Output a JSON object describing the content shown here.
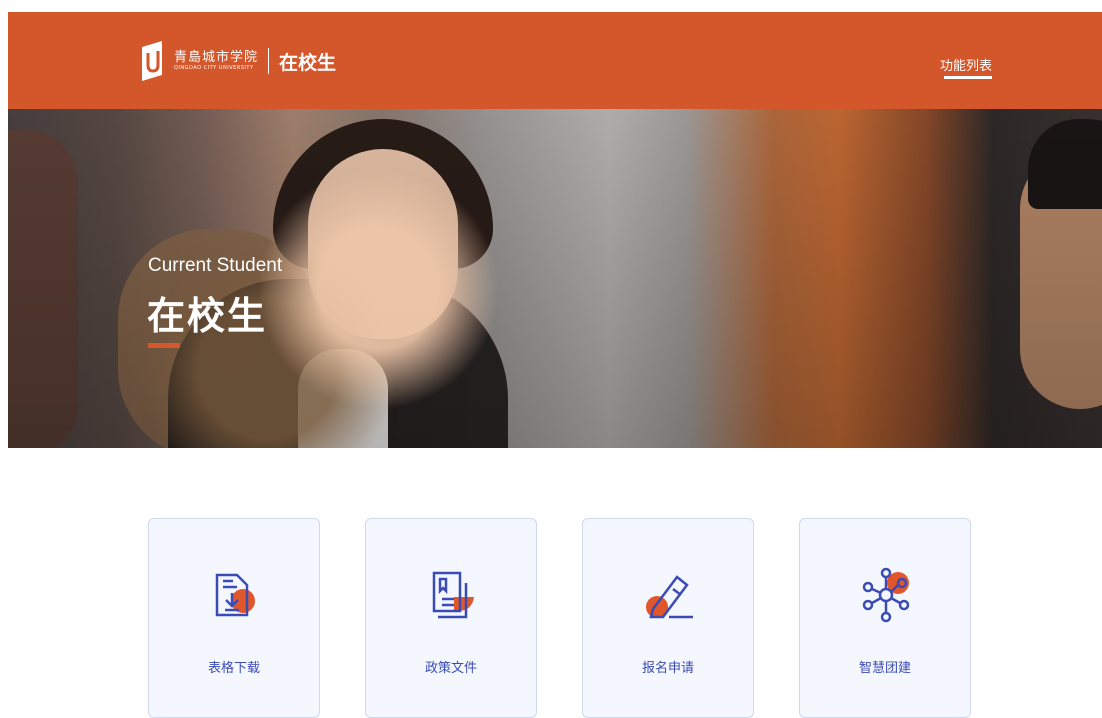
{
  "header": {
    "logo_cn": "青島城市学院",
    "logo_en": "QINGDAO CITY UNIVERSITY",
    "section": "在校生",
    "nav_link": "功能列表",
    "brand_color": "#d4562b"
  },
  "hero": {
    "subtitle": "Current Student",
    "title": "在校生"
  },
  "cards": [
    {
      "label": "表格下载",
      "icon": "form-download-icon"
    },
    {
      "label": "政策文件",
      "icon": "policy-document-icon"
    },
    {
      "label": "报名申请",
      "icon": "registration-icon"
    },
    {
      "label": "智慧团建",
      "icon": "network-icon"
    }
  ]
}
